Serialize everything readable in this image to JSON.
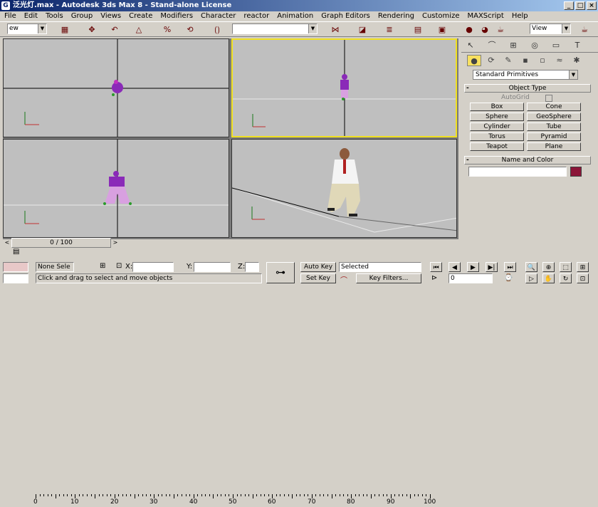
{
  "window": {
    "title": "泛光灯.max - Autodesk 3ds Max 8  - Stand-alone License",
    "icon_glyph": "G"
  },
  "menu": [
    "File",
    "Edit",
    "Tools",
    "Group",
    "Views",
    "Create",
    "Modifiers",
    "Character",
    "reactor",
    "Animation",
    "Graph Editors",
    "Rendering",
    "Customize",
    "MAXScript",
    "Help"
  ],
  "toolbar": {
    "selection_filter": "ew",
    "named_selection": "",
    "view_dropdown": "View"
  },
  "command_panel": {
    "category": "Standard Primitives",
    "rollout_object_type": "Object Type",
    "autogrid_label": "AutoGrid",
    "buttons": [
      "Box",
      "Cone",
      "Sphere",
      "GeoSphere",
      "Cylinder",
      "Tube",
      "Torus",
      "Pyramid",
      "Teapot",
      "Plane"
    ],
    "rollout_name_color": "Name and Color",
    "object_color": "#8b1538"
  },
  "timeline": {
    "slider_label": "0 / 100",
    "ticks": [
      "0",
      "10",
      "20",
      "30",
      "40",
      "50",
      "60",
      "70",
      "80",
      "90",
      "100"
    ],
    "frame_field": "0"
  },
  "status": {
    "selection": "None Sele",
    "x_label": "X:",
    "y_label": "Y:",
    "z_label": "Z:",
    "x_value": "",
    "y_value": "",
    "z_value": "",
    "prompt": "Click and drag to select and move objects",
    "auto_key": "Auto Key",
    "set_key": "Set Key",
    "key_mode": "Selected",
    "key_filters": "Key Filters..."
  },
  "colors": {
    "active_viewport_border": "#f0e020",
    "viewport_bg": "#bfbfbf",
    "title_start": "#0a246a"
  }
}
